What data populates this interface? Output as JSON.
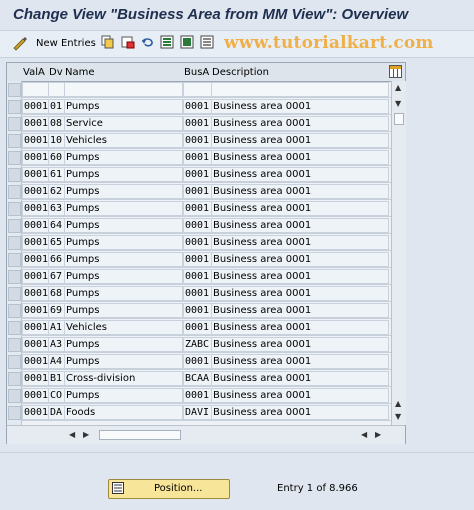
{
  "title": "Change View \"Business Area from MM View\": Overview",
  "toolbar": {
    "new_entries_label": "New Entries",
    "watermark": "www.tutorialkart.com"
  },
  "table": {
    "columns": [
      "ValA",
      "Dv",
      "Name",
      "BusA",
      "Description"
    ],
    "rows": [
      [
        "0001",
        "01",
        "Pumps",
        "0001",
        "Business area 0001"
      ],
      [
        "0001",
        "08",
        "Service",
        "0001",
        "Business area 0001"
      ],
      [
        "0001",
        "10",
        "Vehicles",
        "0001",
        "Business area 0001"
      ],
      [
        "0001",
        "60",
        "Pumps",
        "0001",
        "Business area 0001"
      ],
      [
        "0001",
        "61",
        "Pumps",
        "0001",
        "Business area 0001"
      ],
      [
        "0001",
        "62",
        "Pumps",
        "0001",
        "Business area 0001"
      ],
      [
        "0001",
        "63",
        "Pumps",
        "0001",
        "Business area 0001"
      ],
      [
        "0001",
        "64",
        "Pumps",
        "0001",
        "Business area 0001"
      ],
      [
        "0001",
        "65",
        "Pumps",
        "0001",
        "Business area 0001"
      ],
      [
        "0001",
        "66",
        "Pumps",
        "0001",
        "Business area 0001"
      ],
      [
        "0001",
        "67",
        "Pumps",
        "0001",
        "Business area 0001"
      ],
      [
        "0001",
        "68",
        "Pumps",
        "0001",
        "Business area 0001"
      ],
      [
        "0001",
        "69",
        "Pumps",
        "0001",
        "Business area 0001"
      ],
      [
        "0001",
        "A1",
        "Vehicles",
        "0001",
        "Business area 0001"
      ],
      [
        "0001",
        "A3",
        "Pumps",
        "ZABC",
        "Business area 0001"
      ],
      [
        "0001",
        "A4",
        "Pumps",
        "0001",
        "Business area 0001"
      ],
      [
        "0001",
        "B1",
        "Cross-division",
        "BCAA",
        "Business area 0001"
      ],
      [
        "0001",
        "CO",
        "Pumps",
        "0001",
        "Business area 0001"
      ],
      [
        "0001",
        "DA",
        "Foods",
        "DAVI",
        "Business area 0001"
      ]
    ]
  },
  "footer": {
    "position_label": "Position...",
    "entry_text": "Entry 1 of 8.966"
  }
}
